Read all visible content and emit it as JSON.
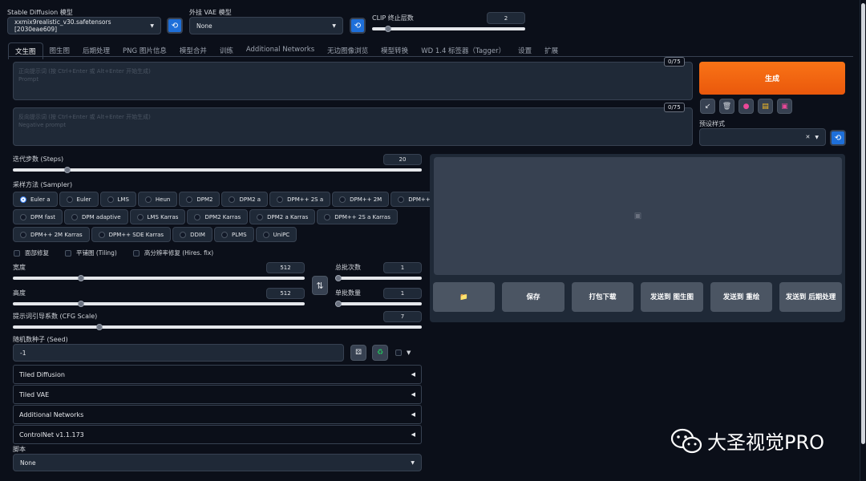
{
  "top": {
    "model_label": "Stable Diffusion 模型",
    "model_value": "xxmix9realistic_v30.safetensors [2030eae609]",
    "vae_label": "外挂 VAE 模型",
    "vae_value": "None",
    "clip_label": "CLIP 终止层数",
    "clip_value": "2",
    "clip_fraction": 0.05
  },
  "tabs": [
    {
      "label": "文生图",
      "active": true
    },
    {
      "label": "图生图"
    },
    {
      "label": "后期处理"
    },
    {
      "label": "PNG 图片信息"
    },
    {
      "label": "模型合并"
    },
    {
      "label": "训练"
    },
    {
      "label": "Additional Networks"
    },
    {
      "label": "无边图像浏览"
    },
    {
      "label": "模型转换"
    },
    {
      "label": "WD 1.4 标签器（Tagger）"
    },
    {
      "label": "设置"
    },
    {
      "label": "扩展"
    }
  ],
  "prompt": {
    "placeholder_line1": "正向提示词 (按 Ctrl+Enter 或 Alt+Enter 开始生成)",
    "placeholder_line2": "Prompt",
    "counter": "0/75"
  },
  "negative": {
    "placeholder_line1": "反向提示词 (按 Ctrl+Enter 或 Alt+Enter 开始生成)",
    "placeholder_line2": "Negative prompt",
    "counter": "0/75"
  },
  "generate_label": "生成",
  "tool_icons": [
    "arrow-icon",
    "trash-icon",
    "palette-icon",
    "clipboard-icon",
    "save-icon"
  ],
  "preset": {
    "label": "预设样式",
    "clear": "✕"
  },
  "steps": {
    "label": "迭代步数 (Steps)",
    "value": "20",
    "fraction": 0.13
  },
  "sampler": {
    "label": "采样方法 (Sampler)",
    "row1": [
      "Euler a",
      "Euler",
      "LMS",
      "Heun",
      "DPM2",
      "DPM2 a",
      "DPM++ 2S a",
      "DPM++ 2M",
      "DPM++ SDE"
    ],
    "row2": [
      "DPM fast",
      "DPM adaptive",
      "LMS Karras",
      "DPM2 Karras",
      "DPM2 a Karras",
      "DPM++ 2S a Karras"
    ],
    "row3": [
      "DPM++ 2M Karras",
      "DPM++ SDE Karras",
      "DDIM",
      "PLMS",
      "UniPC"
    ],
    "selected": "Euler a"
  },
  "checks": [
    "面部修复",
    "平铺图 (Tiling)",
    "高分辨率修复 (Hires. fix)"
  ],
  "width": {
    "label": "宽度",
    "value": "512",
    "fraction": 0.23
  },
  "height": {
    "label": "高度",
    "value": "512",
    "fraction": 0.23
  },
  "batch_count": {
    "label": "总批次数",
    "value": "1",
    "fraction": 0.0
  },
  "batch_size": {
    "label": "单批数量",
    "value": "1",
    "fraction": 0.0
  },
  "swap_icon": "⇅",
  "cfg": {
    "label": "提示词引导系数 (CFG Scale)",
    "value": "7",
    "fraction": 0.21
  },
  "seed": {
    "label": "随机数种子 (Seed)",
    "value": "-1"
  },
  "accordions": [
    "Tiled Diffusion",
    "Tiled VAE",
    "Additional Networks",
    "ControlNet v1.1.173"
  ],
  "script": {
    "label": "脚本",
    "value": "None"
  },
  "output_buttons": [
    "保存",
    "打包下载",
    "发送到 图生图",
    "发送到 重绘",
    "发送到 后期处理"
  ],
  "folder_icon": "📁",
  "watermark": "大圣视觉PRO"
}
